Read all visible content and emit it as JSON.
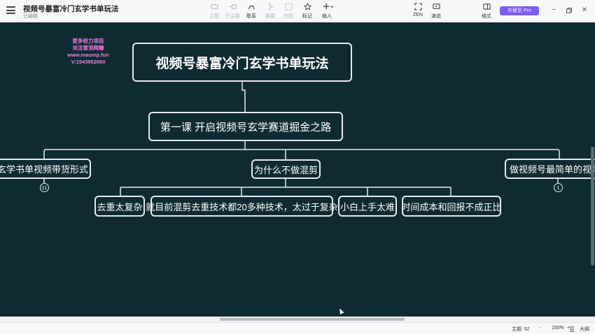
{
  "app": {
    "title": "视频号暴富冷门玄学书单玩法",
    "status": "已编辑"
  },
  "toolbar": {
    "items": [
      {
        "label": "主题",
        "icon": "topic-icon",
        "enabled": false
      },
      {
        "label": "子主题",
        "icon": "subtopic-icon",
        "enabled": false
      },
      {
        "label": "联系",
        "icon": "relationship-icon",
        "enabled": true
      },
      {
        "label": "概要",
        "icon": "summary-icon",
        "enabled": false
      },
      {
        "label": "外框",
        "icon": "boundary-icon",
        "enabled": false
      },
      {
        "label": "标记",
        "icon": "star-icon",
        "enabled": true
      },
      {
        "label": "插入",
        "icon": "plus-icon",
        "enabled": true
      }
    ],
    "zen_label": "ZEN",
    "present_label": "演说",
    "format_label": "格式",
    "upgrade_label": "升级至 Pro"
  },
  "canvas": {
    "background": "#0f2b31",
    "watermark": [
      "更多给力项目",
      "关注冒泡网赚",
      "www.maomp.fun",
      "V:1543952060"
    ],
    "root": "视频号暴富冷门玄学书单玩法",
    "main": "第一课 开启视频号玄学赛道掘金之路",
    "branches": [
      {
        "label": "玄学书单视频带货形式",
        "collapsed_count": "11"
      },
      {
        "label": "为什么不做混剪"
      },
      {
        "label": "做视频号最简单的视频",
        "collapsed_count": "1"
      }
    ],
    "reasons": [
      "去重太复杂",
      "就目前混剪去重技术都20多种技术，太过于复杂",
      "小白上手太难",
      "时间成本和回报不成正比"
    ]
  },
  "statusbar": {
    "topic_count": "主题: 52",
    "zoom": "150%",
    "outline": "大纲"
  }
}
